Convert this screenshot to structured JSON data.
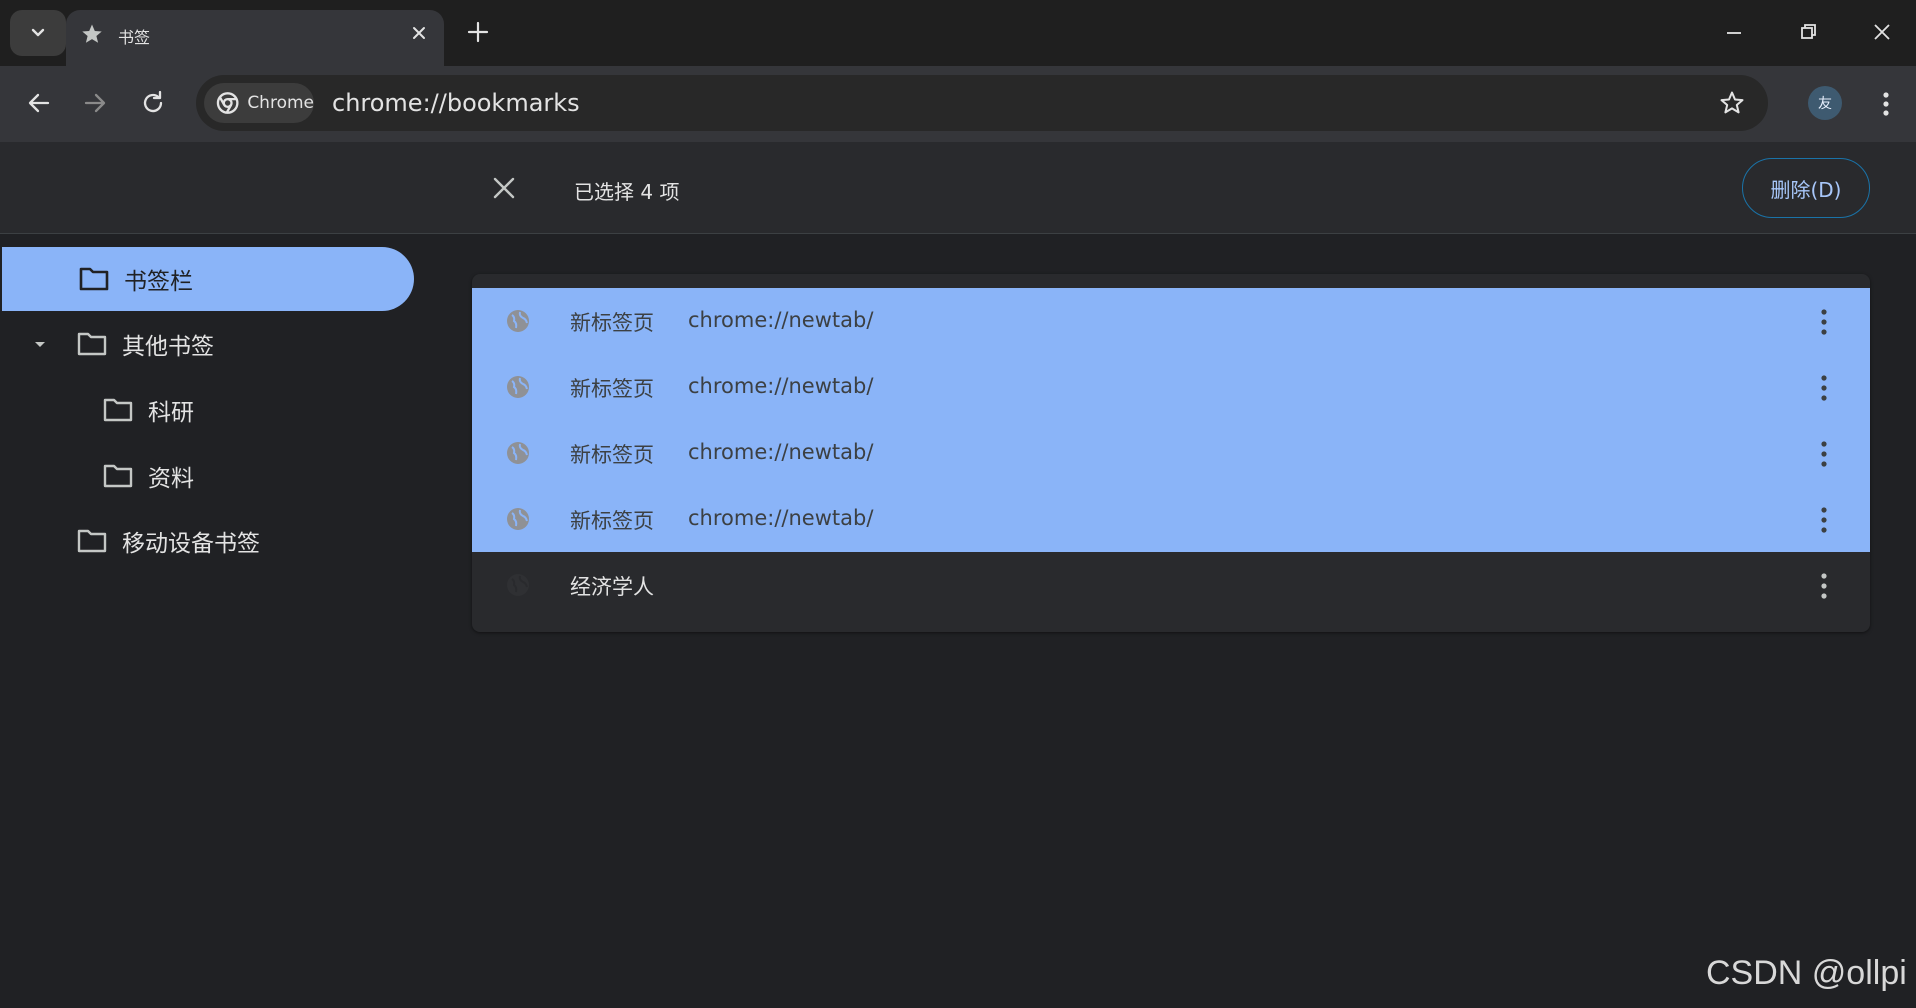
{
  "tab": {
    "title": "书签"
  },
  "omnibox": {
    "chip_label": "Chrome",
    "url": "chrome://bookmarks"
  },
  "profile": {
    "avatar_text": "友"
  },
  "selection": {
    "count_text": "已选择 4 项",
    "delete_label": "删除(D)"
  },
  "sidebar": {
    "items": [
      {
        "label": "书签栏"
      },
      {
        "label": "其他书签"
      },
      {
        "label": "科研"
      },
      {
        "label": "资料"
      },
      {
        "label": "移动设备书签"
      }
    ]
  },
  "bookmarks": [
    {
      "title": "新标签页",
      "url": "chrome://newtab/"
    },
    {
      "title": "新标签页",
      "url": "chrome://newtab/"
    },
    {
      "title": "新标签页",
      "url": "chrome://newtab/"
    },
    {
      "title": "新标签页",
      "url": "chrome://newtab/"
    },
    {
      "title": "经济学人",
      "url": ""
    }
  ],
  "watermark": "CSDN @ollpi",
  "colors": {
    "selection": "#8ab4f8",
    "background": "#202124",
    "accent_border": "#1a73a8"
  }
}
